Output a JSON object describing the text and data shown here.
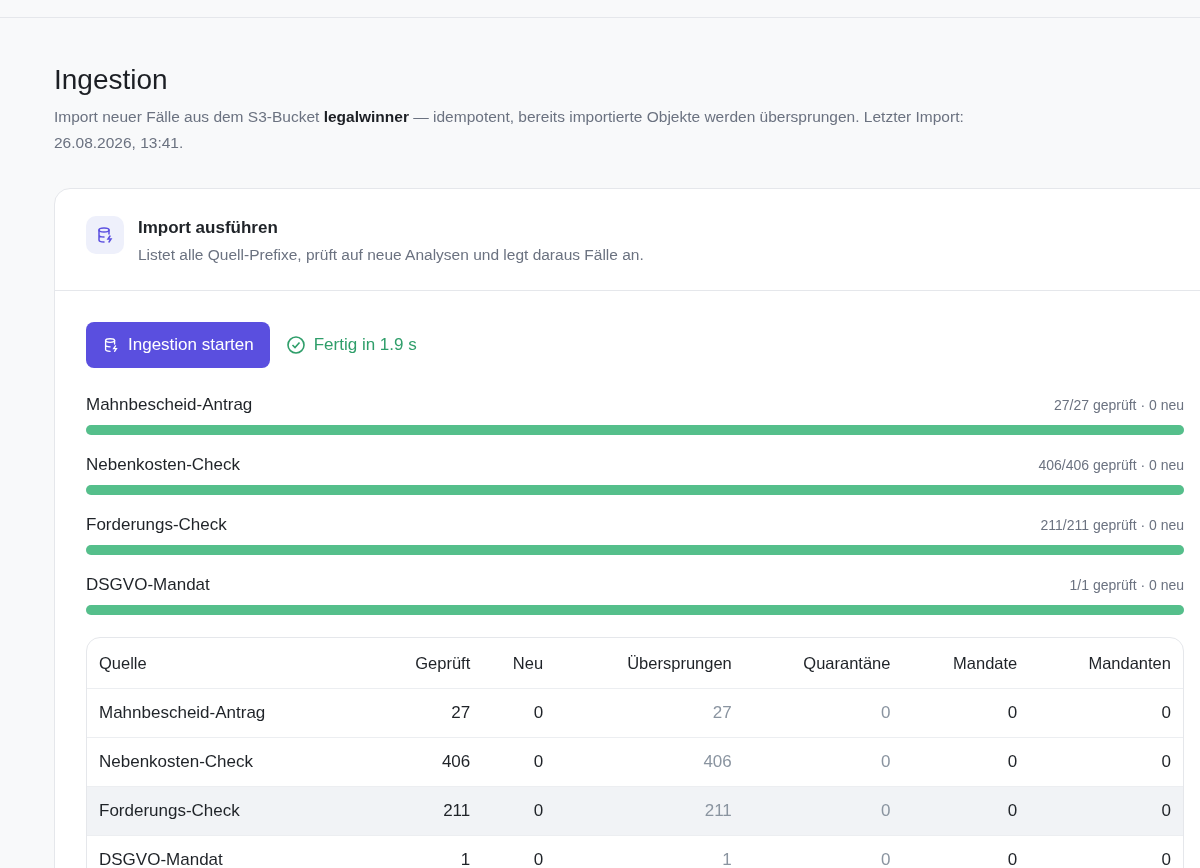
{
  "page": {
    "title": "Ingestion",
    "description": "Import neuer Fälle aus dem S3-Bucket **legalwinner** — idempotent, bereits importierte Objekte werden übersprungen. Letzter Import: 26.08.2026, 13:41."
  },
  "card": {
    "title": "Import ausführen",
    "subtitle": "Listet alle Quell-Prefixe, prüft auf neue Analysen und legt daraus Fälle an."
  },
  "action": {
    "button": "Ingestion starten",
    "status": "Fertig in 1.9 s",
    "done": true
  },
  "progress": [
    {
      "name": "Mahnbescheid-Antrag",
      "reading": "27/27 geprüft · 0 neu",
      "level": 1
    },
    {
      "name": "Nebenkosten-Check",
      "reading": "406/406 geprüft · 0 neu",
      "level": 1
    },
    {
      "name": "Forderungs-Check",
      "reading": "211/211 geprüft · 0 neu",
      "level": 1
    },
    {
      "name": "DSGVO-Mandat",
      "reading": "1/1 geprüft · 0 neu",
      "level": 1
    }
  ],
  "table": {
    "columns": [
      {
        "label": "Quelle",
        "muted": false
      },
      {
        "label": "Geprüft",
        "muted": false
      },
      {
        "label": "Neu",
        "muted": false
      },
      {
        "label": "Übersprungen",
        "muted": true
      },
      {
        "label": "Quarantäne",
        "muted": true
      },
      {
        "label": "Mandate",
        "muted": false
      },
      {
        "label": "Mandanten",
        "muted": false
      }
    ],
    "rows": [
      {
        "cells": [
          "Mahnbescheid-Antrag",
          "27",
          "0",
          "27",
          "0",
          "0",
          "0"
        ],
        "hovered": false
      },
      {
        "cells": [
          "Nebenkosten-Check",
          "406",
          "0",
          "406",
          "0",
          "0",
          "0"
        ],
        "hovered": false
      },
      {
        "cells": [
          "Forderungs-Check",
          "211",
          "0",
          "211",
          "0",
          "0",
          "0"
        ],
        "hovered": true
      },
      {
        "cells": [
          "DSGVO-Mandat",
          "1",
          "0",
          "1",
          "0",
          "0",
          "0"
        ],
        "hovered": false
      }
    ]
  }
}
